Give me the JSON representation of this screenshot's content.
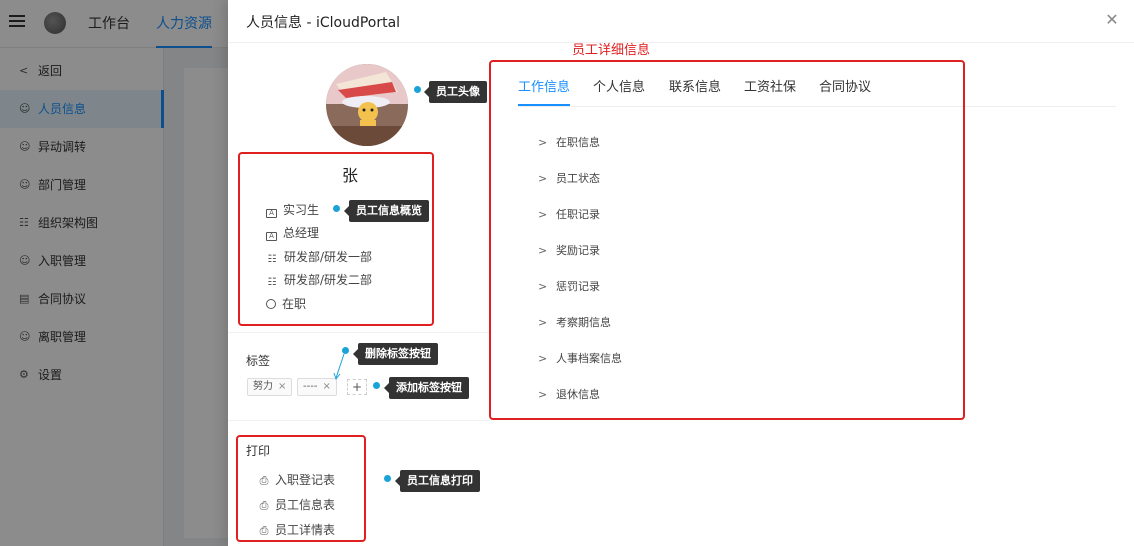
{
  "topbar": {
    "nav_workbench": "工作台",
    "nav_hr": "人力资源"
  },
  "sidebar": {
    "items": [
      {
        "label": "返回",
        "icon": "back-icon"
      },
      {
        "label": "人员信息",
        "icon": "user-icon"
      },
      {
        "label": "异动调转",
        "icon": "user-icon"
      },
      {
        "label": "部门管理",
        "icon": "user-icon"
      },
      {
        "label": "组织架构图",
        "icon": "org-icon"
      },
      {
        "label": "入职管理",
        "icon": "user-icon"
      },
      {
        "label": "合同协议",
        "icon": "contract-icon"
      },
      {
        "label": "离职管理",
        "icon": "user-icon"
      },
      {
        "label": "设置",
        "icon": "gear-icon"
      }
    ]
  },
  "drawer": {
    "title": "人员信息 - iCloudPortal",
    "employee": {
      "name": "张",
      "rows": [
        {
          "text": "实习生",
          "icon": "id-card-icon"
        },
        {
          "text": "总经理",
          "icon": "id-card-icon"
        },
        {
          "text": "研发部/研发一部",
          "icon": "org-icon"
        },
        {
          "text": "研发部/研发二部",
          "icon": "org-icon"
        },
        {
          "text": "在职",
          "icon": "clock-icon"
        }
      ]
    },
    "tags": {
      "label": "标签",
      "items": [
        "努力",
        "----"
      ],
      "add": "+"
    },
    "print": {
      "label": "打印",
      "items": [
        "入职登记表",
        "员工信息表",
        "员工详情表"
      ]
    },
    "tabs": [
      "工作信息",
      "个人信息",
      "联系信息",
      "工资社保",
      "合同协议"
    ],
    "active_tab": "工作信息",
    "sections": [
      "在职信息",
      "员工状态",
      "任职记录",
      "奖励记录",
      "惩罚记录",
      "考察期信息",
      "人事档案信息",
      "退休信息"
    ]
  },
  "annotations": {
    "detail_title": "员工详细信息",
    "avatar": "员工头像",
    "overview": "员工信息概览",
    "delete_tag": "删除标签按钮",
    "add_tag": "添加标签按钮",
    "print": "员工信息打印"
  },
  "colors": {
    "accent": "#1890ff",
    "annotation_red": "#e02020",
    "callout_bg": "#333333",
    "callout_dot": "#1aa3d6"
  }
}
